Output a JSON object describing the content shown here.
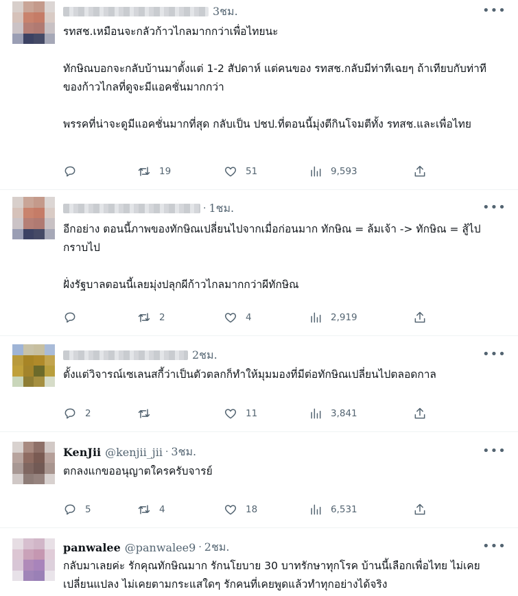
{
  "tweets": [
    {
      "name": "",
      "handle": "",
      "time": "3ชม.",
      "text": "รทสช.เหมือนจะกลัวก้าวไกลมากกว่าเพื่อไทยนะ\n\nทักษิณบอกจะกลับบ้านมาตั้งแต่ 1-2 สัปดาห์ แต่คนของ รทสช.กลับมีท่าทีเฉยๆ ถ้าเทียบกับท่าทีของก้าวไกลที่ดูจะมีแอคชั่นมากกว่า\n\nพรรคที่น่าจะดูมีแอคชั่นมากที่สุด กลับเป็น ปชป.ที่ตอนนี้มุ่งตีกินโจมตีทั้ง รทสช.และเพื่อไทย",
      "replies": "",
      "retweets": "19",
      "likes": "51",
      "views": "9,593"
    },
    {
      "name": "",
      "handle": "",
      "time": "1ชม.",
      "text": "อีกอย่าง ตอนนี้ภาพของทักษิณเปลี่ยนไปจากเมื่อก่อนมาก  ทักษิณ = ล้มเจ้า -> ทักษิณ = สู้ไปกราบไป\n\nฝั่งรัฐบาลตอนนี้เลยมุ่งปลุกผีก้าวไกลมากกว่าผีทักษิณ",
      "replies": "",
      "retweets": "2",
      "likes": "4",
      "views": "2,919"
    },
    {
      "name": "",
      "handle": "",
      "time": "2ชม.",
      "text": "ตั้งแต่วิจารณ์เซเลนสกี้ว่าเป็นตัวตลกก็ทำให้มุมมองที่มีต่อทักษิณเปลี่ยนไปตลอดกาล",
      "replies": "2",
      "retweets": "",
      "likes": "11",
      "views": "3,841"
    },
    {
      "name": "KenJii",
      "handle": "@kenjii_jii",
      "time": "3ชม.",
      "text": "ตกลงแกขออนุญาตใครครับจารย์",
      "replies": "5",
      "retweets": "4",
      "likes": "18",
      "views": "6,531"
    },
    {
      "name": "panwalee",
      "handle": "@panwalee9",
      "time": "2ชม.",
      "text": "กลับมาเลยค่ะ รักคุณทักษิณมาก รักนโยบาย 30 บาทรักษาทุกโรค บ้านนี้เลือกเพื่อไทย ไม่เคยเปลี่ยนแปลง ไม่เคยตามกระแสใดๆ รักคนที่เคยพูดแล้วทำทุกอย่างได้จริง",
      "replies": "",
      "retweets": "",
      "likes": "",
      "views": ""
    }
  ],
  "icons": {
    "reply": "reply-icon",
    "retweet": "retweet-icon",
    "like": "like-icon",
    "views": "views-icon",
    "share": "share-icon",
    "more": "more-icon"
  },
  "colors": {
    "text": "#0f1419",
    "secondary": "#536471",
    "divider": "#eff3f4"
  }
}
